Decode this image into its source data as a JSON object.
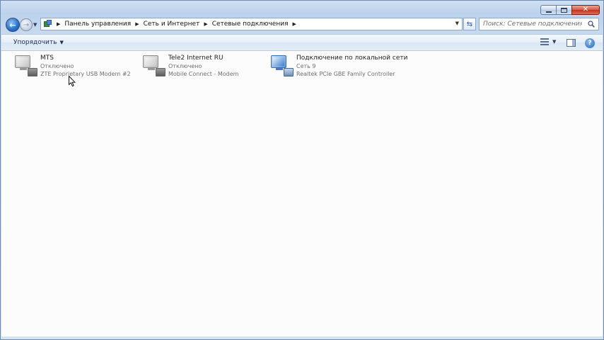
{
  "window": {
    "caption_buttons": [
      "minimize-icon",
      "maximize-icon",
      "close-icon"
    ]
  },
  "address_bar": {
    "breadcrumbs": [
      "Панель управления",
      "Сеть и Интернет",
      "Сетевые подключения"
    ]
  },
  "search": {
    "placeholder": "Поиск: Сетевые подключения"
  },
  "command_bar": {
    "organize_label": "Упорядочить"
  },
  "connections": [
    {
      "name": "MTS",
      "status": "Отключено",
      "device": "ZTE Proprietary USB Modem #2",
      "icon": "modem-connection-icon"
    },
    {
      "name": "Tele2 Internet RU",
      "status": "Отключено",
      "device": "Mobile Connect - Modem",
      "icon": "modem-connection-icon"
    },
    {
      "name": "Подключение по локальной сети",
      "status": "Сеть  9",
      "device": "Realtek PCIe GBE Family Controller",
      "icon": "lan-connection-icon"
    }
  ],
  "colors": {
    "window_frame": "#c6d9ef",
    "content_bg": "#fcfcfd",
    "secondary_text": "#6e6e6e"
  }
}
